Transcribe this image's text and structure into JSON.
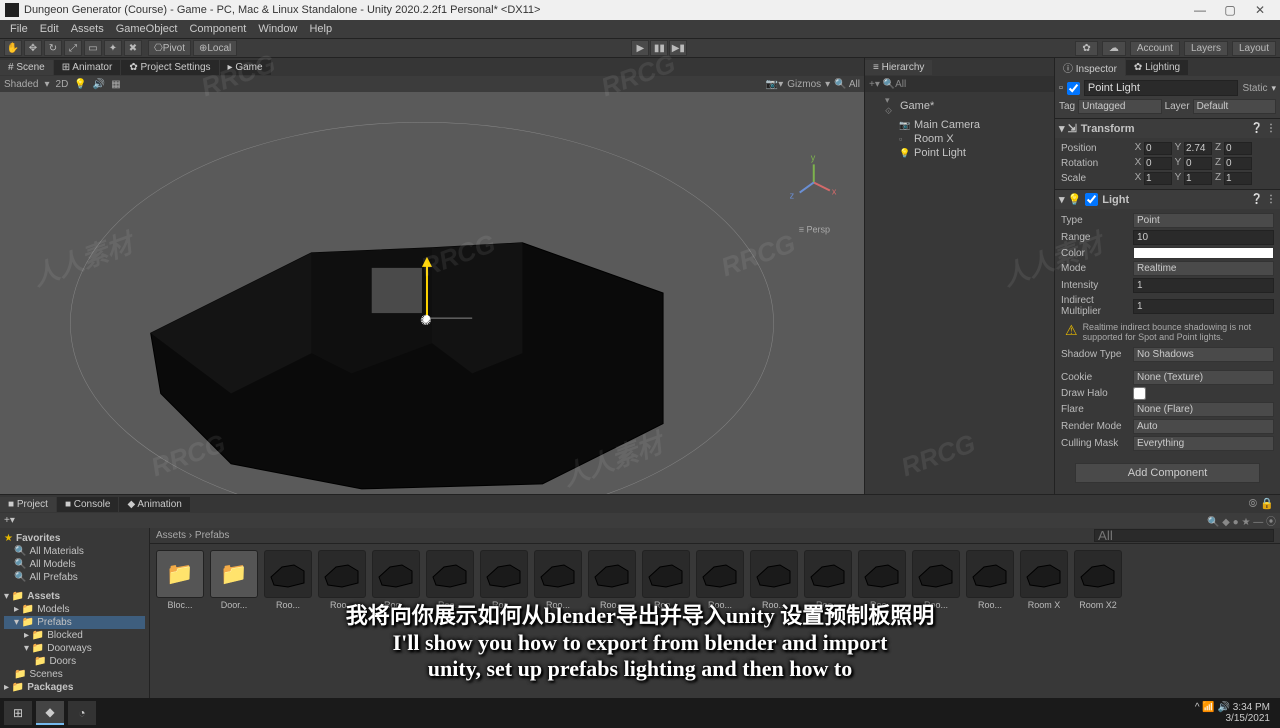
{
  "window": {
    "title": "Dungeon Generator (Course) - Game - PC, Mac & Linux Standalone - Unity 2020.2.2f1 Personal* <DX11>"
  },
  "menubar": [
    "File",
    "Edit",
    "Assets",
    "GameObject",
    "Component",
    "Window",
    "Help"
  ],
  "toolbar": {
    "pivot": "Pivot",
    "local": "Local",
    "account": "Account",
    "layers": "Layers",
    "layout": "Layout"
  },
  "scene": {
    "tabs": {
      "scene": "# Scene",
      "animator": "⊞ Animator",
      "projectSettings": "✿ Project Settings",
      "game": "▸ Game"
    },
    "shading": "Shaded",
    "dim": "2D",
    "gizmos": "Gizmos",
    "persp": "≡ Persp"
  },
  "hierarchy": {
    "tab": "≡ Hierarchy",
    "search": "All",
    "root": "Game*",
    "items": [
      "Main Camera",
      "Room X",
      "Point Light"
    ]
  },
  "inspector": {
    "tabs": {
      "inspector": "ⓘ Inspector",
      "lighting": "✿ Lighting"
    },
    "name": "Point Light",
    "static": "Static",
    "tagLabel": "Tag",
    "tag": "Untagged",
    "layerLabel": "Layer",
    "layer": "Default",
    "transform": {
      "title": "Transform",
      "position": {
        "label": "Position",
        "x": "0",
        "y": "2.74",
        "z": "0"
      },
      "rotation": {
        "label": "Rotation",
        "x": "0",
        "y": "0",
        "z": "0"
      },
      "scale": {
        "label": "Scale",
        "x": "1",
        "y": "1",
        "z": "1"
      }
    },
    "light": {
      "title": "Light",
      "props": {
        "typeLabel": "Type",
        "type": "Point",
        "rangeLabel": "Range",
        "range": "10",
        "colorLabel": "Color",
        "modeLabel": "Mode",
        "mode": "Realtime",
        "intensityLabel": "Intensity",
        "intensity": "1",
        "indirectLabel": "Indirect Multiplier",
        "indirect": "1",
        "warn": "Realtime indirect bounce shadowing is not supported for Spot and Point lights.",
        "shadowLabel": "Shadow Type",
        "shadow": "No Shadows",
        "cookieLabel": "Cookie",
        "cookie": "None (Texture)",
        "haloLabel": "Draw Halo",
        "flareLabel": "Flare",
        "flare": "None (Flare)",
        "renderLabel": "Render Mode",
        "render": "Auto",
        "cullLabel": "Culling Mask",
        "cull": "Everything"
      }
    },
    "addComponent": "Add Component"
  },
  "project": {
    "tabs": {
      "project": "■ Project",
      "console": "■ Console",
      "animation": "◆ Animation"
    },
    "favorites": {
      "title": "Favorites",
      "items": [
        "All Materials",
        "All Models",
        "All Prefabs"
      ]
    },
    "assets": {
      "title": "Assets",
      "models": "Models",
      "prefabs": "Prefabs",
      "blocked": "Blocked",
      "doorways": "Doorways",
      "doors": "Doors",
      "scenes": "Scenes",
      "packages": "Packages"
    },
    "breadcrumb": "Assets › Prefabs",
    "items": [
      {
        "label": "Bloc...",
        "type": "folder"
      },
      {
        "label": "Door...",
        "type": "folder"
      },
      {
        "label": "Roo...",
        "type": "prefab"
      },
      {
        "label": "Roo...",
        "type": "prefab"
      },
      {
        "label": "Roo...",
        "type": "prefab"
      },
      {
        "label": "Roo...",
        "type": "prefab"
      },
      {
        "label": "Roo...",
        "type": "prefab"
      },
      {
        "label": "Roo...",
        "type": "prefab"
      },
      {
        "label": "Roo...",
        "type": "prefab"
      },
      {
        "label": "Roo...",
        "type": "prefab"
      },
      {
        "label": "Roo...",
        "type": "prefab"
      },
      {
        "label": "Roo...",
        "type": "prefab"
      },
      {
        "label": "Roo...",
        "type": "prefab"
      },
      {
        "label": "Roo...",
        "type": "prefab"
      },
      {
        "label": "Roo...",
        "type": "prefab"
      },
      {
        "label": "Roo...",
        "type": "prefab"
      },
      {
        "label": "Room X",
        "type": "prefab"
      },
      {
        "label": "Room X2",
        "type": "prefab"
      }
    ]
  },
  "taskbar": {
    "time": "3:34 PM",
    "date": "3/15/2021"
  },
  "subtitle": {
    "line1": "我将向你展示如何从blender导出并导入unity 设置预制板照明",
    "line2": "I'll show you how to export from blender and import",
    "line3": "unity, set up prefabs lighting and then how to"
  },
  "watermark_en": "RRCG",
  "watermark_cn": "人人素材"
}
